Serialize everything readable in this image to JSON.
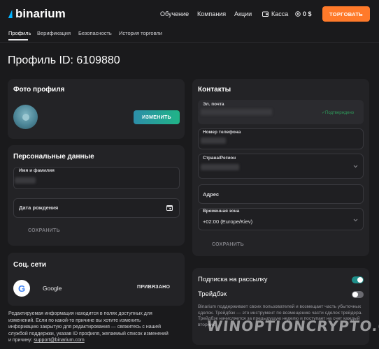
{
  "header": {
    "logo_text": "binarium",
    "nav": [
      "Обучение",
      "Компания",
      "Акции"
    ],
    "cash_label": "Касса",
    "balance": "0 $",
    "trade_label": "ТОРГОВАТЬ"
  },
  "subnav": [
    "Профиль",
    "Верификация",
    "Безопасность",
    "История торговли"
  ],
  "page_title": "Профиль ID: 6109880",
  "photo_card": {
    "title": "Фото профиля",
    "change_label": "ИЗМЕНИТЬ"
  },
  "personal_card": {
    "title": "Персональные данные",
    "name_label": "Имя и фамилия",
    "birth_label": "Дата рождения",
    "save_label": "СОХРАНИТЬ"
  },
  "social_card": {
    "title": "Соц. сети",
    "provider": "Google",
    "status": "ПРИВЯЗАНО"
  },
  "note": {
    "text": "Редактируемая информация находится в полях доступных для изменений. Если по какой-то причине вы хотите изменить информацию закрытую для редактирования — свяжитесь с нашей службой поддержки, указав ID профиля, желаемый список изменений и причину: ",
    "email": "support@binarium.com"
  },
  "contacts_card": {
    "title": "Контакты",
    "email_label": "Эл. почта",
    "email_status": "✓Подтверждено",
    "phone_label": "Номер телефона",
    "country_label": "Страна/Регион",
    "address_label": "Адрес",
    "timezone_label": "Временная зона",
    "timezone_value": "+02:00 (Europe/Kiev)",
    "save_label": "СОХРАНИТЬ"
  },
  "subscription_card": {
    "subscribe_label": "Подписка на рассылку",
    "subscribe_on": true,
    "trade_back_label": "Трейдбэк",
    "trade_back_on": false,
    "description": "Binarium поддерживает своих пользователей и возмещает часть убыточных сделок. Трейдбэк — это инструмент по возмещению части сделок трейдера. Трейдбэк начисляется за предыдущую неделю и поступает на счет каждый вторник."
  },
  "watermark": "WINOPTIONCRYPTO.COM",
  "colors": {
    "accent": "#ff7a2a",
    "toggle_on": "#1f8f8a",
    "confirmed": "#2e9b5a",
    "background": "#1a1a1c",
    "card": "#232326"
  }
}
